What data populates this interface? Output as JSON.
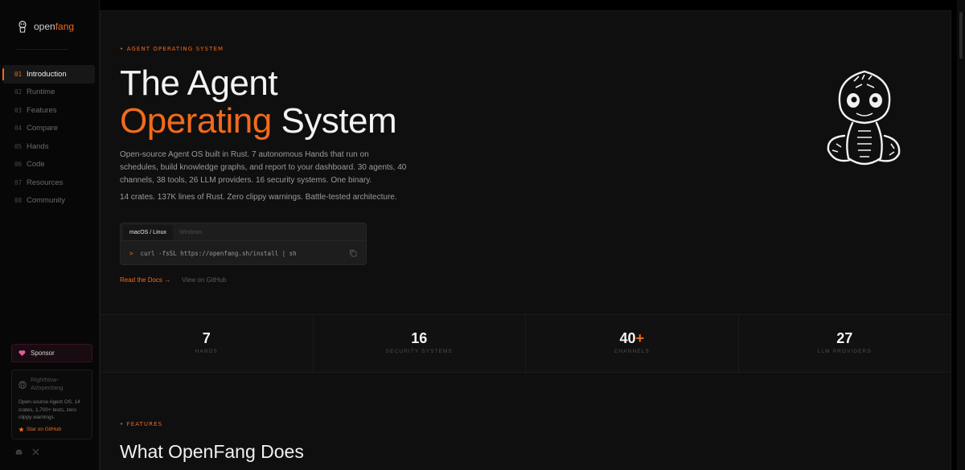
{
  "brand": {
    "name_a": "open",
    "name_b": "fang"
  },
  "nav": [
    {
      "num": "01",
      "label": "Introduction",
      "active": true
    },
    {
      "num": "02",
      "label": "Runtime"
    },
    {
      "num": "03",
      "label": "Features"
    },
    {
      "num": "04",
      "label": "Compare"
    },
    {
      "num": "05",
      "label": "Hands"
    },
    {
      "num": "06",
      "label": "Code"
    },
    {
      "num": "07",
      "label": "Resources"
    },
    {
      "num": "08",
      "label": "Community"
    }
  ],
  "sponsor": {
    "label": "Sponsor"
  },
  "repo": {
    "name": "RightNow-AI/openfang",
    "description": "Open-source Agent OS. 14 crates, 1,700+ tests, zero clippy warnings.",
    "star_label": "Star on GitHub"
  },
  "hero": {
    "eyebrow": "AGENT OPERATING SYSTEM",
    "title_line1": "The Agent",
    "title_accent": "Operating",
    "title_rest": " System",
    "description": "Open-source Agent OS built in Rust. 7 autonomous Hands that run on schedules, build knowledge graphs, and report to your dashboard. 30 agents, 40 channels, 38 tools, 26 LLM providers. 16 security systems. One binary.",
    "description2": "14 crates. 137K lines of Rust. Zero clippy warnings. Battle-tested architecture."
  },
  "terminal": {
    "tabs": [
      "macOS / Linux",
      "Windows"
    ],
    "prompt": ">",
    "command": "curl -fsSL https://openfang.sh/install | sh"
  },
  "cta": {
    "docs": "Read the Docs →",
    "github": "View on GitHub"
  },
  "stats": [
    {
      "value": "7",
      "plus": "",
      "label": "HANDS"
    },
    {
      "value": "16",
      "plus": "",
      "label": "SECURITY SYSTEMS"
    },
    {
      "value": "40",
      "plus": "+",
      "label": "CHANNELS"
    },
    {
      "value": "27",
      "plus": "",
      "label": "LLM PROVIDERS"
    }
  ],
  "features": {
    "eyebrow": "FEATURES",
    "title": "What OpenFang Does"
  },
  "colors": {
    "accent": "#f26a1b",
    "background": "#0f0f0f",
    "sidebar": "#070707"
  }
}
